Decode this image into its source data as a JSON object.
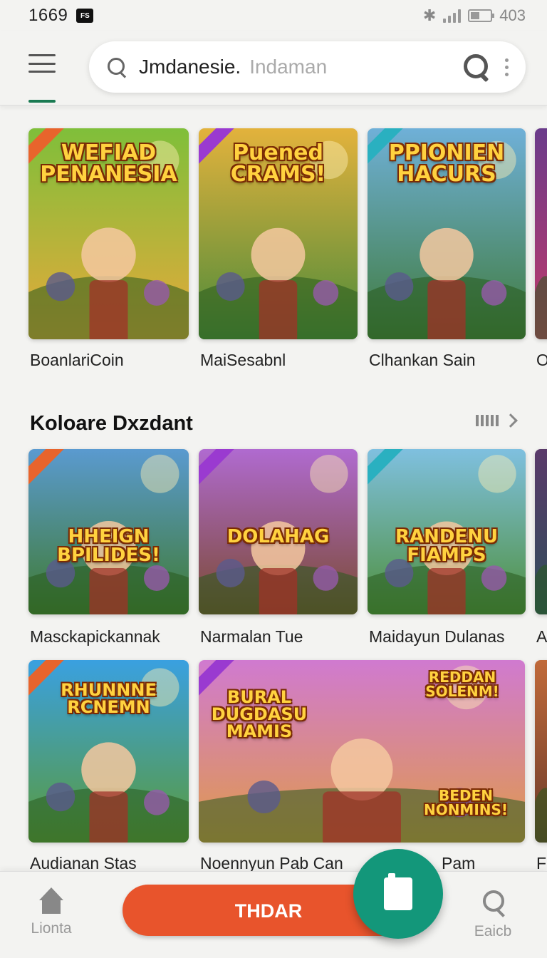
{
  "status_bar": {
    "time": "1669",
    "notification_badge": "FS",
    "battery_text": "403"
  },
  "search": {
    "value": "Jmdanesie.",
    "placeholder": "Indaman"
  },
  "row1": [
    {
      "label": "BoanlariCoin",
      "art_title": "WEFIAD PENANESIA",
      "colors": [
        "#7fbf3a",
        "#e7a93a"
      ]
    },
    {
      "label": "MaiSesabnl",
      "art_title": "Puened CRAMS!",
      "colors": [
        "#e3b23c",
        "#4a8a3a"
      ]
    },
    {
      "label": "Clhankan Sain",
      "art_title": "PPIONIEN HACURS",
      "colors": [
        "#6fb0d8",
        "#3f7a3a"
      ]
    },
    {
      "label": "O",
      "art_title": "",
      "colors": [
        "#6a3b8a",
        "#c23a6a"
      ]
    }
  ],
  "section": {
    "title": "Koloare Dxzdant"
  },
  "row2": [
    {
      "label": "Masckapickannak",
      "art_title": "HHEIGN BPILIDES!",
      "colors": [
        "#5a9ad0",
        "#3f7a2f"
      ]
    },
    {
      "label": "Narmalan Tue",
      "art_title": "DOLAHAG",
      "colors": [
        "#b06ad0",
        "#7a4a2f"
      ]
    },
    {
      "label": "Maidayun Dulanas",
      "art_title": "RANDENU FIAMPS",
      "colors": [
        "#7fc0e0",
        "#4e8f3a"
      ]
    },
    {
      "label": "Ac",
      "art_title": "",
      "colors": [
        "#5a3a6a",
        "#2f4f5a"
      ]
    }
  ],
  "row3": [
    {
      "label": "Audianan Stas",
      "art_title": "RHUNNNE RCNEMN",
      "colors": [
        "#3aa0e0",
        "#5a9a3a"
      ]
    },
    {
      "label": "Noennyun Pab Can",
      "art_title": "BURAL DUGDASU MAMIS",
      "colors": [
        "#d07ad0",
        "#e09a4a"
      ]
    },
    {
      "label": "Fr",
      "art_title": "",
      "colors": [
        "#c06a3a",
        "#6a3a2a"
      ]
    }
  ],
  "row3_partial_label": "Pam",
  "row3_art2_title": "REDDAN SOLENM!",
  "row3_art3_title": "BEDEN NONMINS!",
  "bottom_nav": {
    "home_label": "Lionta",
    "cta_label": "THDAR",
    "search_label": "Eaicb"
  }
}
